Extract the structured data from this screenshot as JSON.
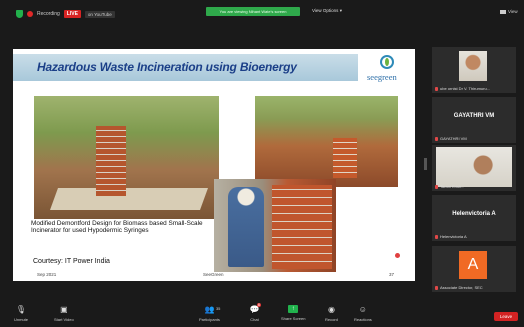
{
  "topbar": {
    "recording_label": "Recording",
    "live_label": "LIVE",
    "youtube_label": "on YouTube",
    "viewing_banner": "You are viewing Nihant Wate's screen",
    "view_options_label": "View Options",
    "view_button_label": "View"
  },
  "slide": {
    "title": "Hazardous Waste Incineration using Bioenergy",
    "logo_text": "seegreen",
    "caption": "Modified Demontford Design for Biomass based Small-Scale Incinerator for used Hypodermic Syringes",
    "courtesy": "Courtesy: IT Power India",
    "footer_date": "Sep 2021",
    "footer_center": "SeeGreen",
    "footer_page": "37"
  },
  "participants": [
    {
      "name": "ube ornist Dr V. Thirumuru...",
      "type": "video"
    },
    {
      "name": "GAYATHRI VM",
      "label": "GAYATHRI VM",
      "type": "name"
    },
    {
      "name": "Tarani Krish...",
      "type": "video"
    },
    {
      "name": "Helenvictoria A",
      "label": "Helenvictoria A",
      "type": "name"
    },
    {
      "name": "Associate Director, SEC",
      "initial": "A",
      "type": "avatar"
    }
  ],
  "toolbar": {
    "mute": "Unmute",
    "video": "Start Video",
    "participants": "Participants",
    "participant_count": "35",
    "chat": "Chat",
    "chat_badge": "6",
    "share": "Share Screen",
    "record": "Record",
    "reactions": "Reactions",
    "leave": "Leave"
  },
  "colors": {
    "live": "#d82424",
    "share_green": "#21b34d",
    "title_blue": "#1b3f88",
    "avatar_orange": "#f06a24"
  }
}
